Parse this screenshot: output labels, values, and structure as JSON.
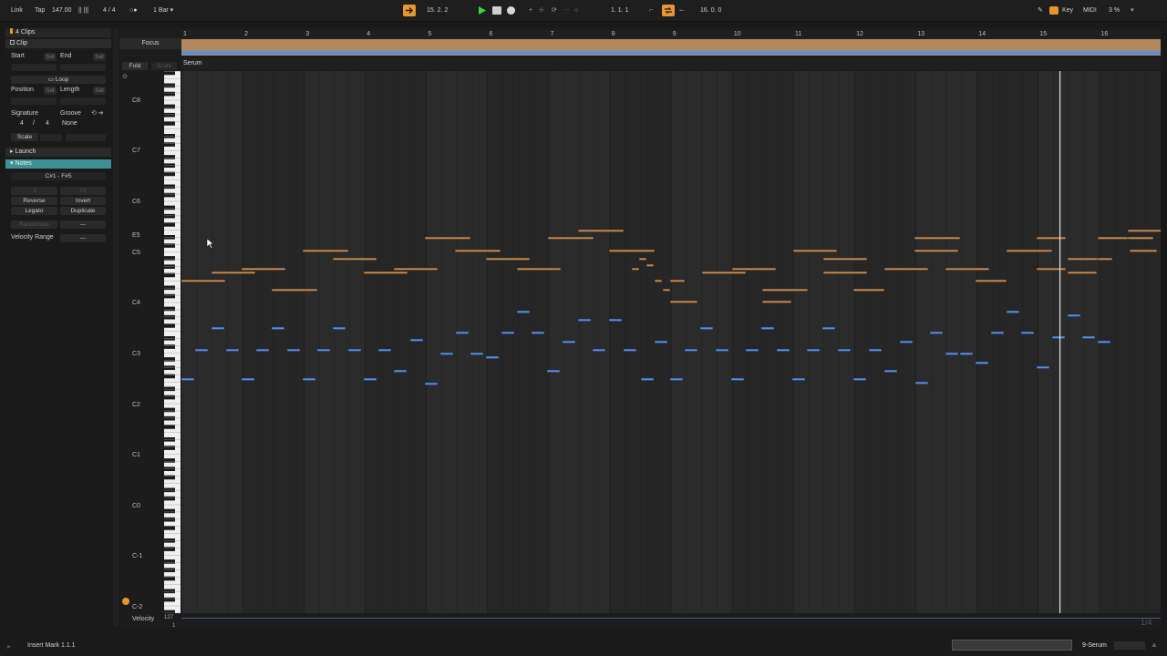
{
  "transport": {
    "link": "Link",
    "tap": "Tap",
    "tempo": "147.00",
    "metronome_icons": "||  |||",
    "signature": "4 / 4",
    "quantize_icons": "○●",
    "quantize": "1 Bar",
    "arrangement_position": "15.  2.  2",
    "loop_start": "1.   1.   1",
    "loop_length": "16.   0.   0",
    "key_label": "Key",
    "midi_label": "MIDI",
    "cpu": "3 %"
  },
  "left_panel": {
    "clips_header": "4 Clips",
    "clip_section": "Clip",
    "start_label": "Start",
    "end_label": "End",
    "set_label": "Set",
    "loop_label": "Loop",
    "position_label": "Position",
    "length_label": "Length",
    "signature_label": "Signature",
    "groove_label": "Groove",
    "sig_num": "4",
    "sig_slash": "/",
    "sig_den": "4",
    "groove_value": "None",
    "scale_label": "Scale",
    "launch_section": "Launch",
    "notes_section": "Notes",
    "note_range": "C#1 - F#5",
    "div2": ":2",
    "mul2": "×2",
    "reverse": "Reverse",
    "invert": "Invert",
    "legato": "Legato",
    "duplicate": "Duplicate",
    "randomize": "Randomize",
    "randomize_value": "---",
    "velocity_range_label": "Velocity Range",
    "velocity_range_value": "---"
  },
  "editor": {
    "focus": "Focus",
    "fold": "Fold",
    "scale": "Scale",
    "clip_name": "Serum",
    "ruler": [
      "1",
      "2",
      "3",
      "4",
      "5",
      "6",
      "7",
      "8",
      "9",
      "10",
      "11",
      "12",
      "13",
      "14",
      "15",
      "16"
    ],
    "note_labels": [
      "C8",
      "C7",
      "C6",
      "E5",
      "C5",
      "C4",
      "C3",
      "C2",
      "C1",
      "C0",
      "C-1",
      "C-2"
    ],
    "velocity_label": "Velocity",
    "velocity_max": "127",
    "velocity_min": "1",
    "page_indicator": "1/4"
  },
  "status": {
    "message": "Insert Mark 1.1.1",
    "device": "9-Serum"
  },
  "colors": {
    "accent_orange": "#e8962e",
    "play_green": "#3fd13f",
    "note_orange": "#c38b55",
    "note_blue": "#5b8fe0",
    "clip_header": "#b38a60",
    "notes_header_teal": "#3f8f96"
  }
}
